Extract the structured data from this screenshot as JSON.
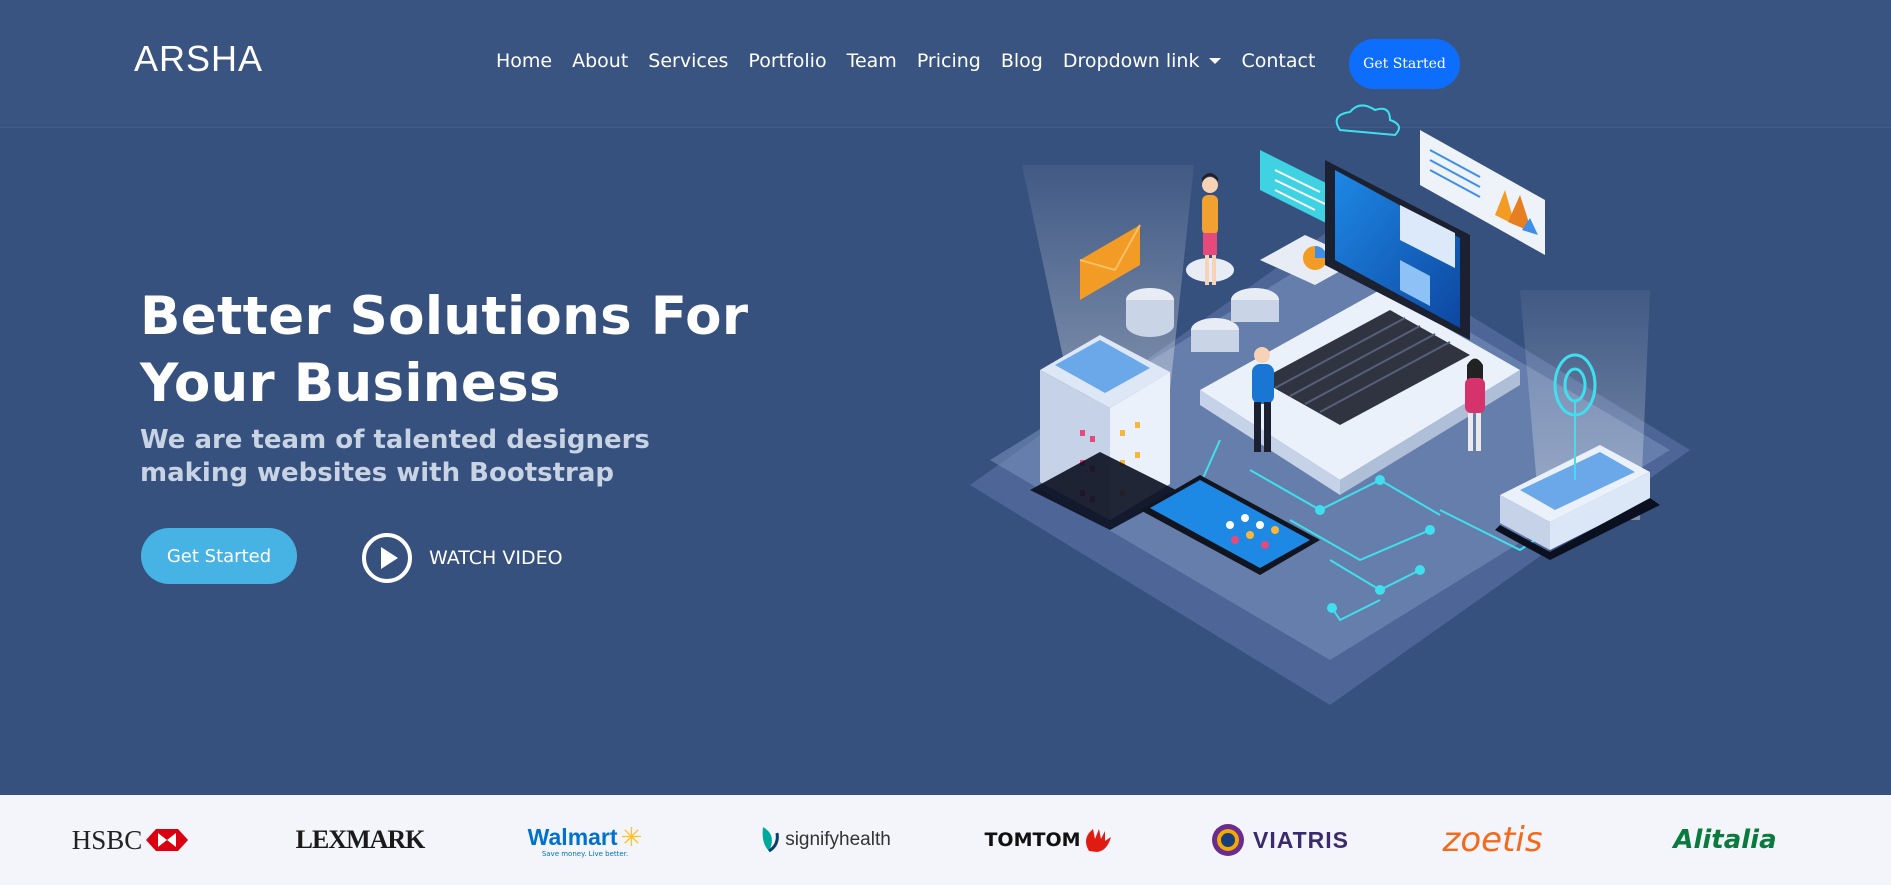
{
  "brand": {
    "name": "ARSHA"
  },
  "nav": {
    "items": [
      "Home",
      "About",
      "Services",
      "Portfolio",
      "Team",
      "Pricing",
      "Blog",
      "Dropdown link",
      "Contact"
    ],
    "cta": "Get Started"
  },
  "hero": {
    "title": "Better Solutions For Your Business",
    "subtitle": "We are team of talented designers making websites with Bootstrap",
    "cta": "Get Started",
    "watch_video": "WATCH VIDEO"
  },
  "clients": [
    "HSBC",
    "LEXMARK",
    "Walmart",
    "signifyhealth",
    "TOMTOM",
    "VIATRIS",
    "zoetis",
    "Alitalia"
  ],
  "client_taglines": {
    "walmart": "Save money. Live better."
  },
  "colors": {
    "background": "#37517e",
    "accent": "#47b2e4",
    "header_button": "#0d6efd",
    "clients_bg": "#f3f5fa"
  },
  "icons": [
    "play-circle-icon",
    "caret-down-icon"
  ]
}
